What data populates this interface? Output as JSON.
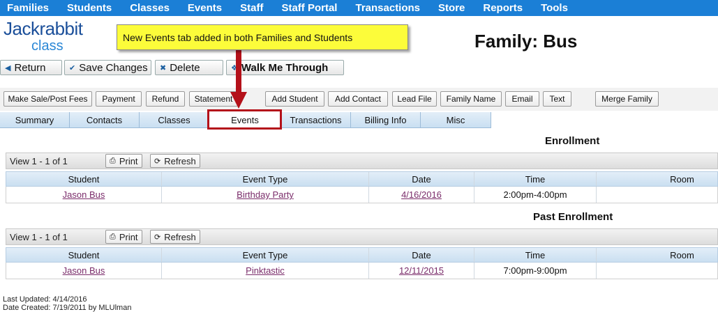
{
  "nav": [
    "Families",
    "Students",
    "Classes",
    "Events",
    "Staff",
    "Staff Portal",
    "Transactions",
    "Store",
    "Reports",
    "Tools"
  ],
  "logo": {
    "line1": "Jackrabbit",
    "line2": "class"
  },
  "page_title": "Family: Bus",
  "callout": "New Events tab added in both Families and Students",
  "actions": {
    "return": "Return",
    "save": "Save Changes",
    "delete": "Delete",
    "walk": "Walk Me Through"
  },
  "toolbar": [
    "Make Sale/Post Fees",
    "Payment",
    "Refund",
    "Statement",
    "Add Student",
    "Add Contact",
    "Lead File",
    "Family Name",
    "Email",
    "Text",
    "Merge Family"
  ],
  "tabs": [
    "Summary",
    "Contacts",
    "Classes",
    "Events",
    "Transactions",
    "Billing Info",
    "Misc"
  ],
  "active_tab": "Events",
  "colors": {
    "nav_bg": "#1b7fd6",
    "highlight": "#b4111a",
    "callout_bg": "#fcfc3a"
  },
  "enrollment": {
    "title": "Enrollment",
    "view": "View 1 - 1 of 1",
    "print": "Print",
    "refresh": "Refresh",
    "columns": [
      "Student",
      "Event Type",
      "Date",
      "Time",
      "Room"
    ],
    "rows": [
      {
        "student": "Jason Bus",
        "event_type": "Birthday Party",
        "date": "4/16/2016",
        "time": "2:00pm-4:00pm",
        "room": ""
      }
    ]
  },
  "past_enrollment": {
    "title": "Past Enrollment",
    "view": "View 1 - 1 of 1",
    "print": "Print",
    "refresh": "Refresh",
    "columns": [
      "Student",
      "Event Type",
      "Date",
      "Time",
      "Room"
    ],
    "rows": [
      {
        "student": "Jason Bus",
        "event_type": "Pinktastic",
        "date": "12/11/2015",
        "time": "7:00pm-9:00pm",
        "room": ""
      }
    ]
  },
  "footer": {
    "last_updated": "Last Updated: 4/14/2016",
    "date_created": "Date Created: 7/19/2011 by MLUlman"
  }
}
